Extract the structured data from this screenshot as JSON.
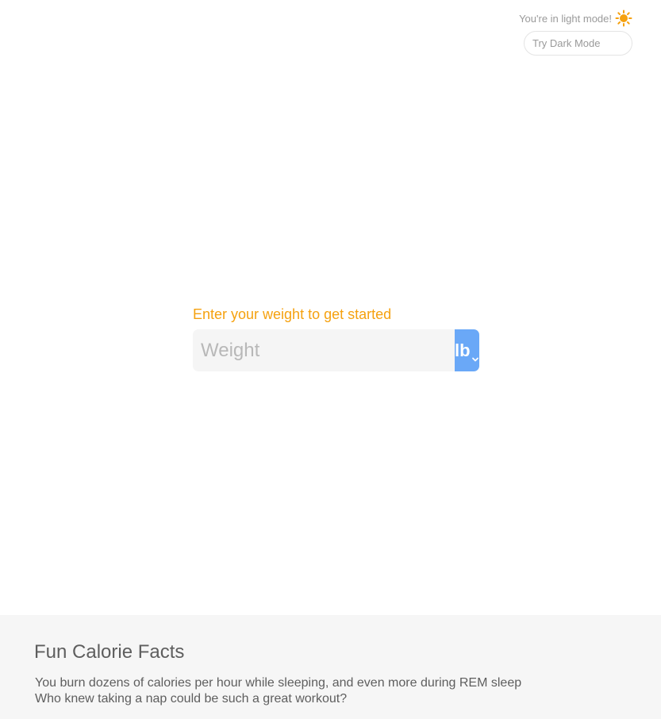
{
  "theme": {
    "status_text": "You're in light mode!",
    "status_icon": "sun-icon",
    "toggle_label": "Try Dark Mode",
    "accent_color": "#f5a10f"
  },
  "weight_entry": {
    "prompt": "Enter your weight to get started",
    "input": {
      "value": "",
      "placeholder": "Weight"
    },
    "unit": {
      "selected": "lb",
      "icon": "chevron-down-icon",
      "color": "#6aa8f7"
    }
  },
  "facts": {
    "title": "Fun Calorie Facts",
    "lines": [
      "You burn dozens of calories per hour while sleeping, and even more during REM sleep",
      "Who knew taking a nap could be such a great workout?"
    ]
  }
}
